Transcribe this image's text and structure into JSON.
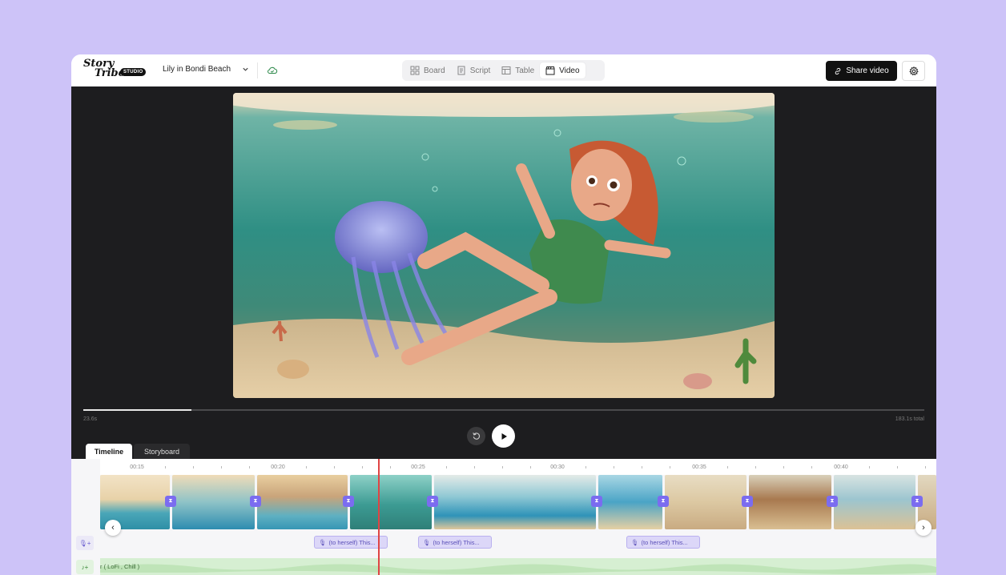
{
  "app": {
    "logo_text_1": "Story",
    "logo_text_2": "Tribe",
    "logo_badge": "STUDIO",
    "project_name": "Lily in Bondi Beach"
  },
  "nav": {
    "tabs": [
      {
        "label": "Board",
        "icon": "grid-icon",
        "active": false
      },
      {
        "label": "Script",
        "icon": "script-icon",
        "active": false
      },
      {
        "label": "Table",
        "icon": "table-icon",
        "active": false
      },
      {
        "label": "Video",
        "icon": "clapper-icon",
        "active": true
      }
    ]
  },
  "actions": {
    "share_label": "Share video",
    "settings_icon": "gear-icon"
  },
  "player": {
    "current_time": "23.6s",
    "total_time": "183.1s total",
    "progress": 0.129
  },
  "views": {
    "timeline_label": "Timeline",
    "storyboard_label": "Storyboard"
  },
  "timeline": {
    "ruler_labels": [
      "00:15",
      "00:20",
      "00:25",
      "00:30",
      "00:35",
      "00:40"
    ],
    "voiceover_clips": [
      {
        "text": "(to herself) This..."
      },
      {
        "text": "(to herself) This..."
      },
      {
        "text": "(to herself) This..."
      }
    ],
    "music_label": "r ( LoFi , Chill )"
  },
  "colors": {
    "accent": "#7b6cf0",
    "playhead": "#e04444",
    "music": "#d6efd2",
    "background": "#cdc3f8"
  }
}
